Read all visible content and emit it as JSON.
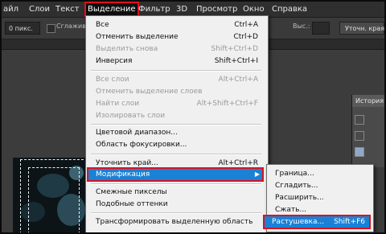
{
  "menubar": {
    "items": [
      "айл",
      "Слои",
      "Текст",
      "Выделение",
      "Фильтр",
      "3D",
      "Просмотр",
      "Окно",
      "Справка"
    ]
  },
  "options": {
    "feather_value": "0 пикс.",
    "antialias_label": "Сглажива",
    "height_label": "Выс.:",
    "refine_edge_button": "Уточн. края"
  },
  "panel": {
    "tab_label": "История"
  },
  "select_menu": {
    "items": [
      {
        "label": "Все",
        "shortcut": "Ctrl+A",
        "enabled": true
      },
      {
        "label": "Отменить выделение",
        "shortcut": "Ctrl+D",
        "enabled": true
      },
      {
        "label": "Выделить снова",
        "shortcut": "Shift+Ctrl+D",
        "enabled": false
      },
      {
        "label": "Инверсия",
        "shortcut": "Shift+Ctrl+I",
        "enabled": true
      },
      {
        "label": "Все слои",
        "shortcut": "Alt+Ctrl+A",
        "enabled": false
      },
      {
        "label": "Отменить выделение слоев",
        "shortcut": "",
        "enabled": false
      },
      {
        "label": "Найти слои",
        "shortcut": "Alt+Shift+Ctrl+F",
        "enabled": false
      },
      {
        "label": "Изолировать слои",
        "shortcut": "",
        "enabled": false
      },
      {
        "label": "Цветовой диапазон...",
        "shortcut": "",
        "enabled": true
      },
      {
        "label": "Область фокусировки...",
        "shortcut": "",
        "enabled": true
      },
      {
        "label": "Уточнить край...",
        "shortcut": "Alt+Ctrl+R",
        "enabled": true
      },
      {
        "label": "Модификация",
        "shortcut": "",
        "enabled": true
      },
      {
        "label": "Смежные пикселы",
        "shortcut": "",
        "enabled": true
      },
      {
        "label": "Подобные оттенки",
        "shortcut": "",
        "enabled": true
      },
      {
        "label": "Трансформировать выделенную область",
        "shortcut": "",
        "enabled": true
      }
    ]
  },
  "modify_submenu": {
    "items": [
      {
        "label": "Граница...",
        "shortcut": ""
      },
      {
        "label": "Сгладить...",
        "shortcut": ""
      },
      {
        "label": "Расширить...",
        "shortcut": ""
      },
      {
        "label": "Сжать...",
        "shortcut": ""
      },
      {
        "label": "Растушевка...",
        "shortcut": "Shift+F6"
      }
    ]
  },
  "colors": {
    "highlight": "#1a82d6",
    "annotation_red": "#e0101e",
    "menu_bg": "#f0f0f0",
    "app_bg": "#3b3b3b"
  }
}
